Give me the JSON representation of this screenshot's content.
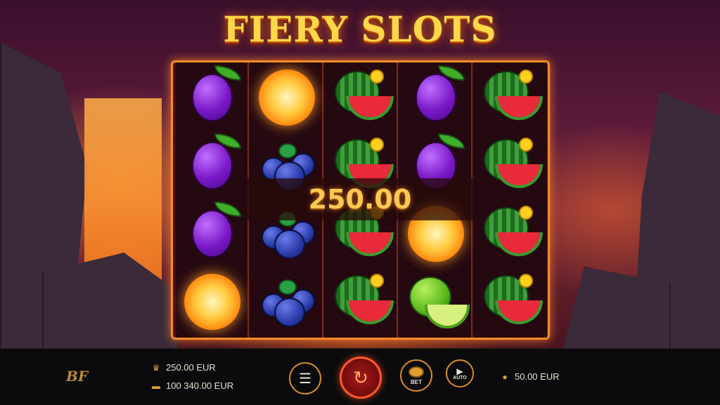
{
  "game": {
    "title": "FIERY SLOTS",
    "win_amount": "250.00"
  },
  "reels": [
    {
      "symbols": [
        "plum",
        "plum",
        "plum",
        "sun"
      ]
    },
    {
      "symbols": [
        "sun",
        "blueberry",
        "blueberry",
        "blueberry"
      ]
    },
    {
      "symbols": [
        "watermelon",
        "watermelon",
        "watermelon",
        "watermelon"
      ]
    },
    {
      "symbols": [
        "plum",
        "plum",
        "sun",
        "lime"
      ]
    },
    {
      "symbols": [
        "watermelon",
        "watermelon",
        "watermelon",
        "watermelon"
      ]
    }
  ],
  "bottom_bar": {
    "logo": "BF",
    "last_win": "250.00 EUR",
    "balance": "100 340.00 EUR",
    "bet_label": "BET",
    "auto_label": "AUTO",
    "bet_amount": "50.00 EUR",
    "icons": {
      "win": "trophy-icon",
      "balance": "wallet-icon",
      "menu": "menu-icon",
      "spin": "spin-arrow-icon",
      "bet": "coin-stack-icon",
      "auto": "play-icon"
    }
  },
  "colors": {
    "frame": "#ff8a2a",
    "title": "#ffd84a",
    "win_text": "#ffc850",
    "bar_bg": "#0b0b0d"
  }
}
